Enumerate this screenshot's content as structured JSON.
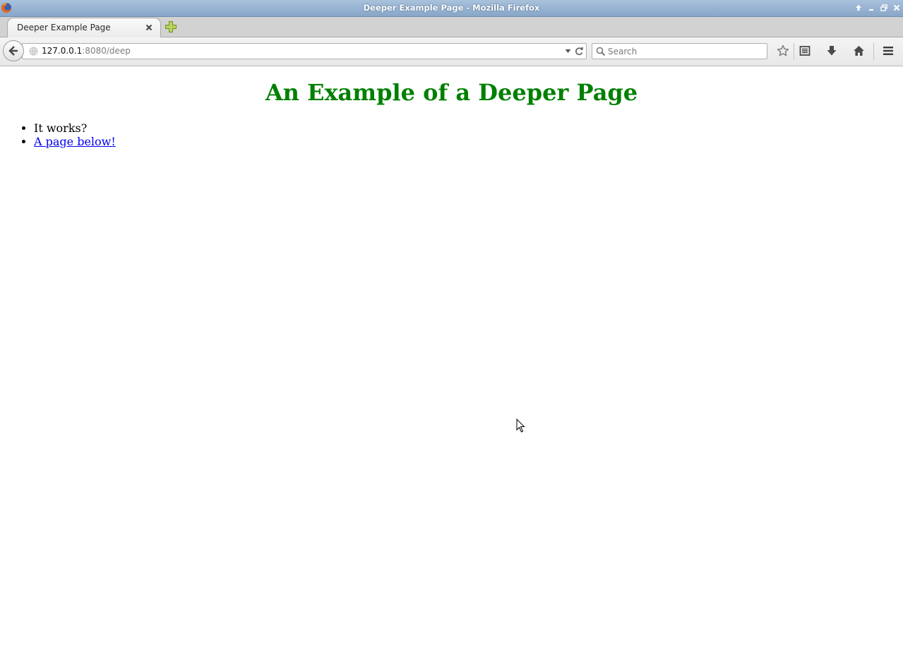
{
  "window": {
    "title": "Deeper Example Page - Mozilla Firefox"
  },
  "tabs": [
    {
      "label": "Deeper Example Page",
      "active": true
    }
  ],
  "navbar": {
    "url_host": "127.0.0.1",
    "url_rest": ":8080/deep",
    "search_placeholder": "Search"
  },
  "page": {
    "heading": "An Example of a Deeper Page",
    "heading_color": "#008000",
    "list": [
      {
        "text": "It works?",
        "is_link": false
      },
      {
        "text": "A page below!",
        "is_link": true
      }
    ],
    "link_color": "#0000ee"
  },
  "icons": {
    "titlebar": [
      "firefox-logo-icon",
      "window-up-icon",
      "window-minimize-icon",
      "window-maximize-icon",
      "window-close-icon"
    ],
    "toolbar": [
      "back-arrow-icon",
      "bookmark-star-icon",
      "reading-list-icon",
      "downloads-icon",
      "home-icon",
      "hamburger-menu-icon"
    ]
  }
}
